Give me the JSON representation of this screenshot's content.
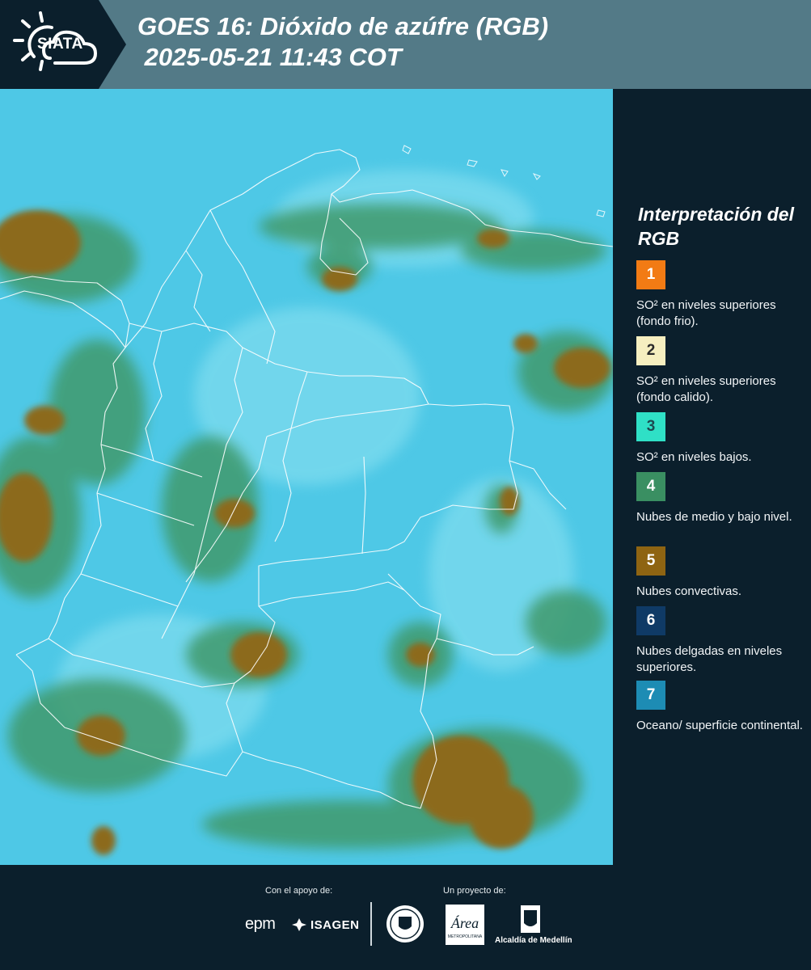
{
  "header": {
    "logo_text": "SIATA",
    "title": "GOES 16: Dióxido de azúfre (RGB)\n 2025-05-21 11:43 COT"
  },
  "map": {
    "colors": {
      "background": "#4ec8e6",
      "low_so2": "#2bd3c9",
      "mid_clouds": "#3f9a6c",
      "convective": "#8c6a1e",
      "border": "#ffffff"
    }
  },
  "legend": {
    "title": "Interpretación del RGB",
    "items": [
      {
        "number": "1",
        "color": "#f27b14",
        "label": "SO² en niveles superiores (fondo frio)."
      },
      {
        "number": "2",
        "color": "#f6efc0",
        "label": "SO² en niveles superiores (fondo calido)."
      },
      {
        "number": "3",
        "color": "#2fe0c6",
        "label": "SO² en niveles bajos."
      },
      {
        "number": "4",
        "color": "#3a8f62",
        "label": "Nubes de medio y bajo nivel."
      },
      {
        "number": "5",
        "color": "#8e6412",
        "label": "Nubes convectivas."
      },
      {
        "number": "6",
        "color": "#0f3a66",
        "label": "Nubes delgadas en niveles superiores."
      },
      {
        "number": "7",
        "color": "#1d8cb4",
        "label": "Oceano/ superficie continental."
      }
    ]
  },
  "footer": {
    "support_label": "Con el apoyo de:",
    "project_label": "Un proyecto de:",
    "epm": "epm",
    "isagen": "ISAGEN",
    "area_text": "Área",
    "area_sub": "METROPOLITANA",
    "alcaldia": "Alcaldía de Medellín"
  }
}
